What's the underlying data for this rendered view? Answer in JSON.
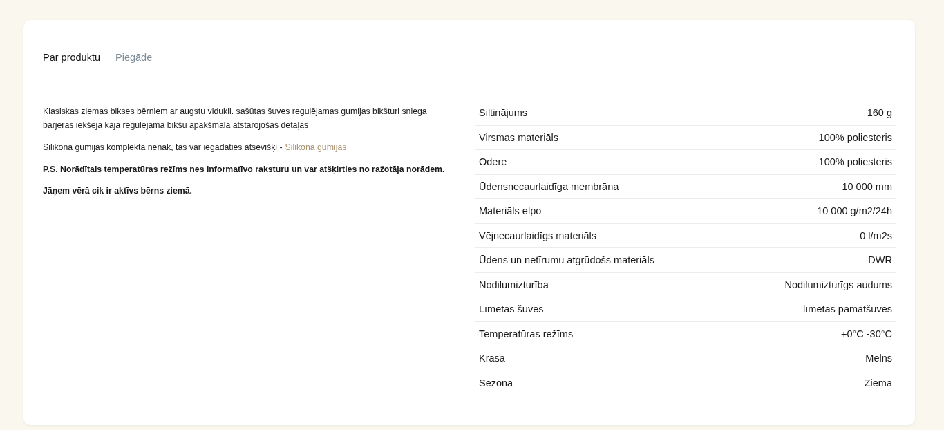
{
  "tabs": [
    {
      "label": "Par produktu",
      "selected": true
    },
    {
      "label": "Piegāde",
      "selected": false
    }
  ],
  "description": [
    {
      "kind": "plain",
      "text": "Klasiskas ziemas bikses bērniem ar augstu vidukli. sašūtas šuves regulējamas gumijas bikšturi sniega barjeras iekšējā kāja regulējama bikšu apakšmala atstarojošās detaļas"
    },
    {
      "kind": "plain",
      "text": "Silikona gumijas komplektā nenāk, tās var iegādāties atsevišķi -",
      "link": "Silikona gumijas"
    },
    {
      "kind": "bold",
      "text": "P.S. Norādītais temperatūras režīms nes informatīvo raksturu un var atšķirties no ražotāja norādem."
    },
    {
      "kind": "bold",
      "text": "Jāņem vērā cik ir aktīvs bērns ziemā."
    }
  ],
  "specs": [
    {
      "name": "Siltinājums",
      "value": "160 g"
    },
    {
      "name": "Virsmas materiāls",
      "value": "100% poliesteris"
    },
    {
      "name": "Odere",
      "value": "100% poliesteris"
    },
    {
      "name": "Ūdensnecaurlaidīga membrāna",
      "value": "10 000 mm"
    },
    {
      "name": "Materiāls elpo",
      "value": "10 000 g/m2/24h"
    },
    {
      "name": "Vējnecaurlaidīgs materiāls",
      "value": "0 l/m2s"
    },
    {
      "name": "Ūdens un netīrumu atgrūdošs materiāls",
      "value": "DWR"
    },
    {
      "name": "Nodilumizturība",
      "value": "Nodilumizturīgs audums"
    },
    {
      "name": "Līmētas šuves",
      "value": "līmētas pamatšuves"
    },
    {
      "name": "Temperatūras režīms",
      "value": "+0°C -30°C"
    },
    {
      "name": "Krāsa",
      "value": "Melns"
    },
    {
      "name": "Sezona",
      "value": "Ziema"
    }
  ]
}
